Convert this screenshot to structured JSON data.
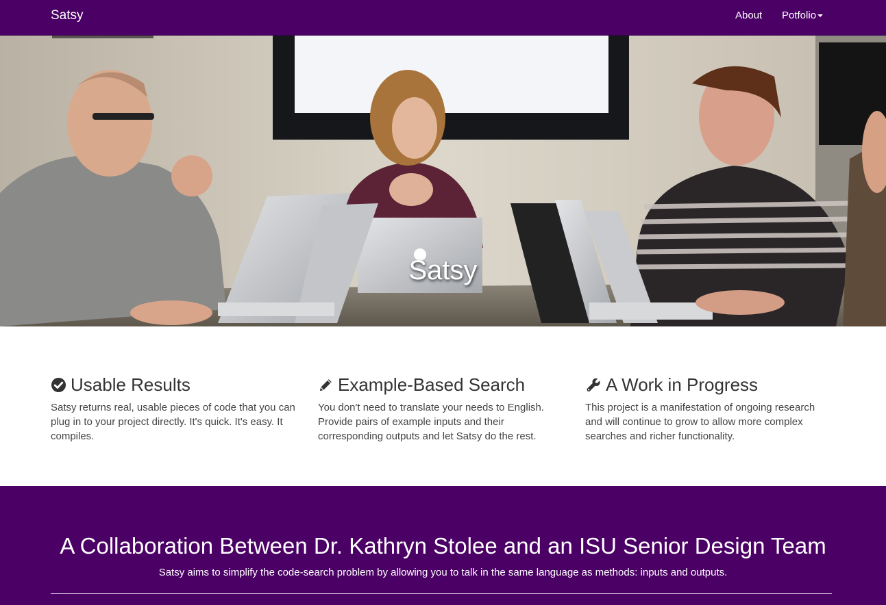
{
  "navbar": {
    "brand": "Satsy",
    "links": [
      {
        "label": "About"
      },
      {
        "label": "Potfolio"
      }
    ],
    "background": "#4b0065"
  },
  "hero": {
    "title": "Satsy",
    "image_description_icon": "photo"
  },
  "features": [
    {
      "icon": "check-circle-icon",
      "title": "Usable Results",
      "text": "Satsy returns real, usable pieces of code that you can plug in to your project directly. It's quick. It's easy. It compiles."
    },
    {
      "icon": "pencil-icon",
      "title": "Example-Based Search",
      "text": "You don't need to translate your needs to English. Provide pairs of example inputs and their corresponding outputs and let Satsy do the rest."
    },
    {
      "icon": "wrench-icon",
      "title": "A Work in Progress",
      "text": "This project is a manifestation of ongoing research and will continue to grow to allow more complex searches and richer functionality."
    }
  ],
  "collab": {
    "title": "A Collaboration Between Dr. Kathryn Stolee and an ISU Senior Design Team",
    "subtitle": "Satsy aims to simplify the code-search problem by allowing you to talk in the same language as methods: inputs and outputs.",
    "background": "#4b0065"
  }
}
